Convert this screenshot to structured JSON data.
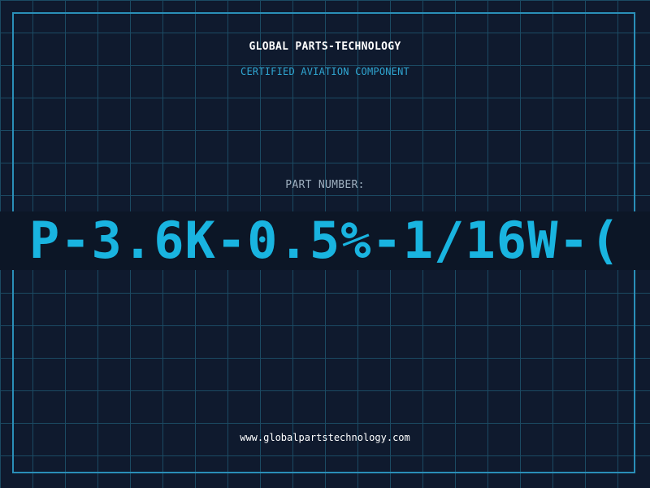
{
  "header": {
    "company": "GLOBAL PARTS-TECHNOLOGY",
    "subtitle": "CERTIFIED AVIATION COMPONENT"
  },
  "part": {
    "label": "PART NUMBER:",
    "number": "P-3.6K-0.5%-1/16W-("
  },
  "footer": {
    "website": "www.globalpartstechnology.com"
  },
  "colors": {
    "background": "#0f1a2e",
    "grid": "#1b4a63",
    "border": "#2a8fb8",
    "accent": "#19b4e0",
    "label": "#9fb0c0"
  }
}
